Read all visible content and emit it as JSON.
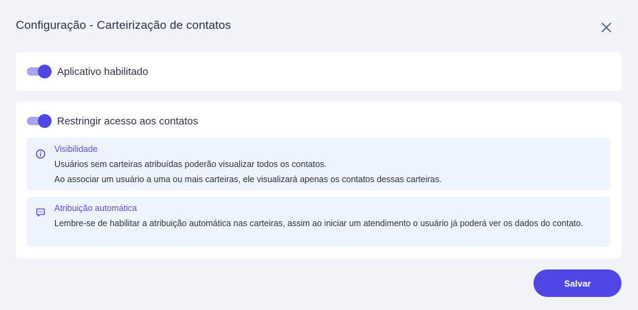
{
  "dialog": {
    "title": "Configuração - Carteirização de contatos",
    "close_icon": "close-icon"
  },
  "app_toggle": {
    "label": "Aplicativo habilitado",
    "enabled": true
  },
  "restrict_toggle": {
    "label": "Restringir acesso aos contatos",
    "enabled": true
  },
  "info_visibility": {
    "icon": "info-icon",
    "title": "Visibilidade",
    "line1": "Usuários sem carteiras atribuídas poderão visualizar todos os contatos.",
    "line2": "Ao associar um usuário a uma ou mais carteiras, ele visualizará apenas os contatos dessas carteiras."
  },
  "info_assignment": {
    "icon": "chat-icon",
    "title": "Atribuição automática",
    "text": "Lembre-se de habilitar a atribuição automática nas carteiras, assim ao iniciar um atendimento o usuário já poderá ver os dados do contato."
  },
  "footer": {
    "save_label": "Salvar"
  },
  "colors": {
    "accent": "#4f46e5",
    "toggle_track": "#a6a3ef",
    "info_bg": "#eef4fd",
    "page_bg": "#f1f3f8"
  }
}
